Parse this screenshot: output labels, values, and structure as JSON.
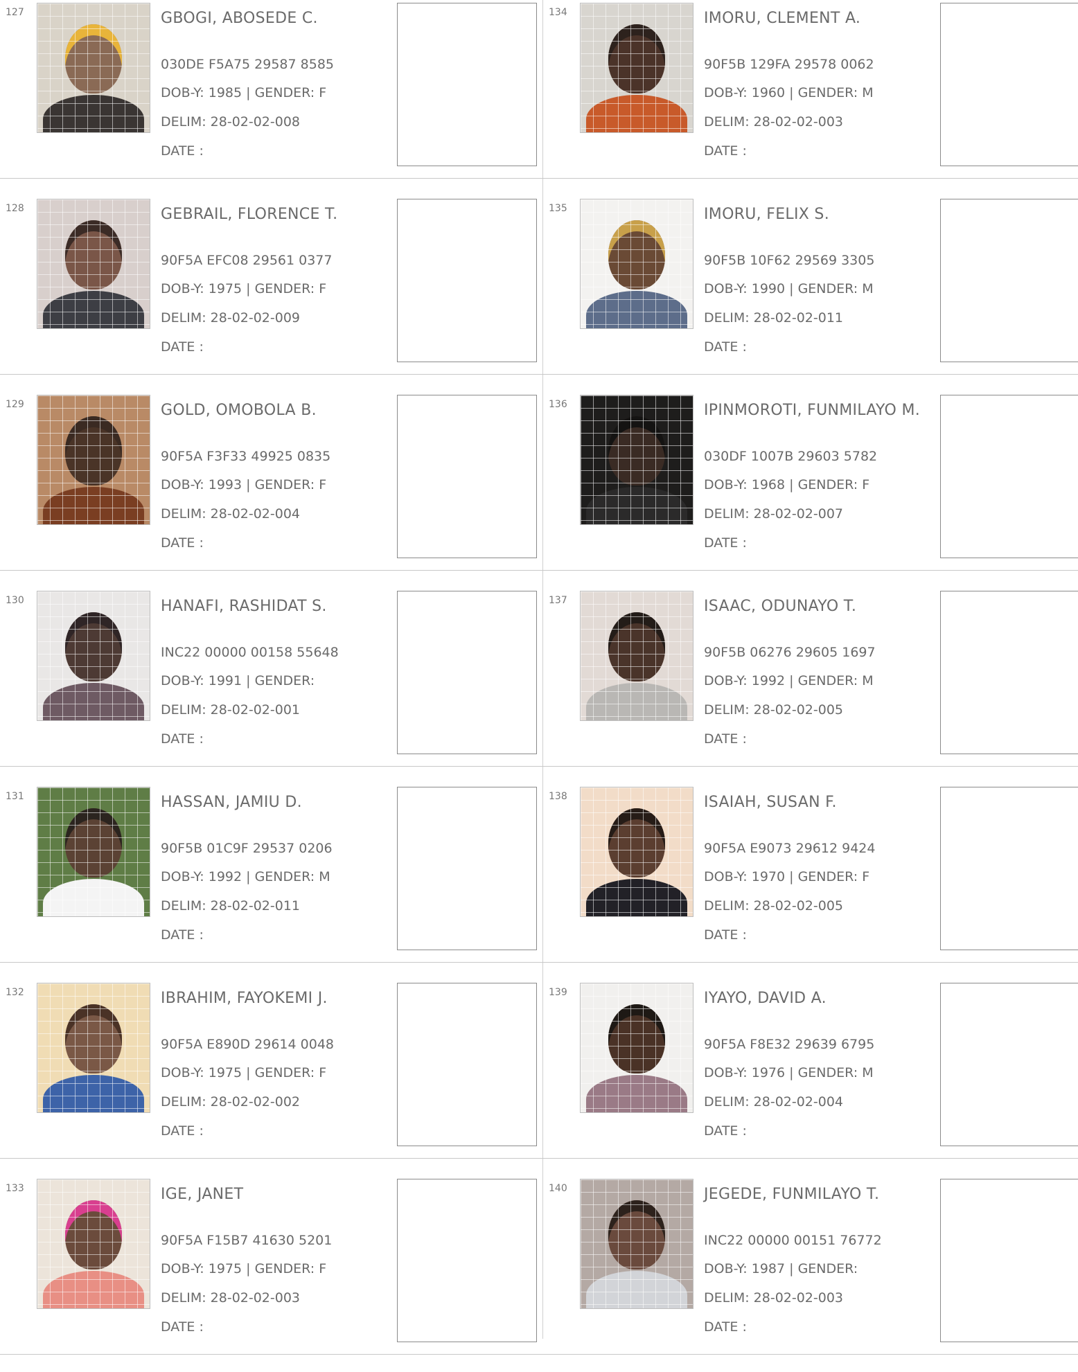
{
  "date_label": "DATE  :",
  "entries": [
    {
      "number": "127",
      "name": "GBOGI, ABOSEDE C.",
      "vin": "030DE F5A75 29587 8585",
      "dob_gender": "DOB-Y: 1985  | GENDER: F",
      "delim": "DELIM: 28-02-02-008",
      "photo": {
        "bg": "#d9d3c8",
        "skin": "#8a6a55",
        "cloth": "#3a3533",
        "hair": "#e8b43a"
      }
    },
    {
      "number": "128",
      "name": "GEBRAIL, FLORENCE T.",
      "vin": "90F5A EFC08 29561 0377",
      "dob_gender": "DOB-Y: 1975  | GENDER: F",
      "delim": "DELIM: 28-02-02-009",
      "photo": {
        "bg": "#d8cfcc",
        "skin": "#7a5648",
        "cloth": "#3d3e44",
        "hair": "#3b2b26"
      }
    },
    {
      "number": "129",
      "name": "GOLD, OMOBOLA B.",
      "vin": "90F5A F3F33 49925 0835",
      "dob_gender": "DOB-Y: 1993  | GENDER: F",
      "delim": "DELIM: 28-02-02-004",
      "photo": {
        "bg": "#b98a66",
        "skin": "#4a3427",
        "cloth": "#7a3e22",
        "hair": "#3a2a22"
      }
    },
    {
      "number": "130",
      "name": "HANAFI, RASHIDAT S.",
      "vin": "INC22 00000 00158 55648",
      "dob_gender": "DOB-Y: 1991  | GENDER:",
      "delim": "DELIM: 28-02-02-001",
      "photo": {
        "bg": "#e9e7e6",
        "skin": "#4d3a34",
        "cloth": "#6e5a63",
        "hair": "#2f2526"
      }
    },
    {
      "number": "131",
      "name": "HASSAN, JAMIU D.",
      "vin": "90F5B 01C9F 29537 0206",
      "dob_gender": "DOB-Y: 1992  | GENDER: M",
      "delim": "DELIM: 28-02-02-011",
      "photo": {
        "bg": "#5f7d46",
        "skin": "#5b4234",
        "cloth": "#f4f4f4",
        "hair": "#2b241f"
      }
    },
    {
      "number": "132",
      "name": "IBRAHIM, FAYOKEMI J.",
      "vin": "90F5A E890D 29614 0048",
      "dob_gender": "DOB-Y: 1975  | GENDER: F",
      "delim": "DELIM: 28-02-02-002",
      "photo": {
        "bg": "#f0dcb4",
        "skin": "#7a5846",
        "cloth": "#3d63a8",
        "hair": "#4a3226"
      }
    },
    {
      "number": "133",
      "name": "IGE, JANET",
      "vin": "90F5A F15B7 41630 5201",
      "dob_gender": "DOB-Y: 1975  | GENDER: F",
      "delim": "DELIM: 28-02-02-003",
      "photo": {
        "bg": "#ece4da",
        "skin": "#6b4b3c",
        "cloth": "#e88f84",
        "hair": "#d83f8f"
      }
    },
    {
      "number": "134",
      "name": "IMORU, CLEMENT A.",
      "vin": "90F5B 129FA 29578 0062",
      "dob_gender": "DOB-Y: 1960  | GENDER: M",
      "delim": "DELIM: 28-02-02-003",
      "photo": {
        "bg": "#d8d5cf",
        "skin": "#4b3329",
        "cloth": "#c85a2a",
        "hair": "#2d221d"
      }
    },
    {
      "number": "135",
      "name": "IMORU, FELIX S.",
      "vin": "90F5B 10F62 29569 3305",
      "dob_gender": "DOB-Y: 1990  | GENDER: M",
      "delim": "DELIM: 28-02-02-011",
      "photo": {
        "bg": "#f3f2f0",
        "skin": "#6a4a35",
        "cloth": "#5d6d8a",
        "hair": "#c8a04a"
      }
    },
    {
      "number": "136",
      "name": "IPINMOROTI, FUNMILAYO M.",
      "vin": "030DF 1007B 29603 5782",
      "dob_gender": "DOB-Y: 1968  | GENDER: F",
      "delim": "DELIM: 28-02-02-007",
      "photo": {
        "bg": "#1e1d1c",
        "skin": "#3a2b24",
        "cloth": "#2b2a2a",
        "hair": "#141312"
      }
    },
    {
      "number": "137",
      "name": "ISAAC, ODUNAYO T.",
      "vin": "90F5B 06276 29605 1697",
      "dob_gender": "DOB-Y: 1992  | GENDER: M",
      "delim": "DELIM: 28-02-02-005",
      "photo": {
        "bg": "#e2dad5",
        "skin": "#4a342a",
        "cloth": "#b9b7b4",
        "hair": "#231c18"
      }
    },
    {
      "number": "138",
      "name": "ISAIAH, SUSAN F.",
      "vin": "90F5A E9073 29612 9424",
      "dob_gender": "DOB-Y: 1970  | GENDER: F",
      "delim": "DELIM: 28-02-02-005",
      "photo": {
        "bg": "#f2dcc8",
        "skin": "#5b3e30",
        "cloth": "#222127",
        "hair": "#261c17"
      }
    },
    {
      "number": "139",
      "name": "IYAYO, DAVID A.",
      "vin": "90F5A F8E32 29639 6795",
      "dob_gender": "DOB-Y: 1976  | GENDER: M",
      "delim": "DELIM: 28-02-02-004",
      "photo": {
        "bg": "#f1f0ee",
        "skin": "#4a3226",
        "cloth": "#9a7a86",
        "hair": "#1e1915"
      }
    },
    {
      "number": "140",
      "name": "JEGEDE, FUNMILAYO T.",
      "vin": "INC22 00000 00151 76772",
      "dob_gender": "DOB-Y: 1987  | GENDER:",
      "delim": "DELIM: 28-02-02-003",
      "photo": {
        "bg": "#b4a9a4",
        "skin": "#6a4a3d",
        "cloth": "#d2d4d8",
        "hair": "#2d221c"
      }
    }
  ]
}
